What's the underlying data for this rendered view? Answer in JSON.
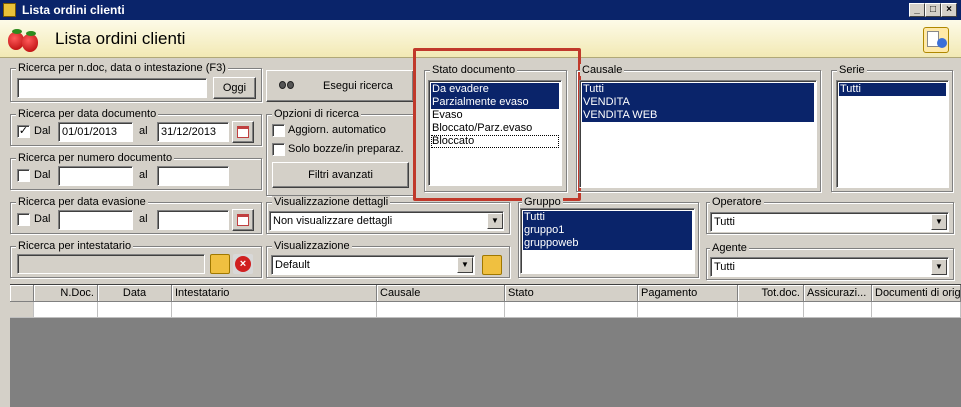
{
  "window": {
    "title": "Lista ordini clienti",
    "controls": [
      "_",
      "□",
      "×"
    ]
  },
  "header": {
    "title": "Lista ordini clienti"
  },
  "search_ndoc": {
    "legend": "Ricerca per n.doc, data o intestazione (F3)",
    "value": "",
    "button": "Oggi"
  },
  "esegui": {
    "label": "Esegui ricerca"
  },
  "data_doc": {
    "legend": "Ricerca per data documento",
    "checked": "✓",
    "dal_label": "Dal",
    "dal_value": "01/01/2013",
    "al_label": "al",
    "al_value": "31/12/2013"
  },
  "opzioni": {
    "legend": "Opzioni di ricerca",
    "option1": "Aggiorn. automatico",
    "option2": "Solo bozze/in preparaz.",
    "filtri_button": "Filtri avanzati"
  },
  "numero_doc": {
    "legend": "Ricerca per numero documento",
    "dal_label": "Dal",
    "al_label": "al"
  },
  "data_evasione": {
    "legend": "Ricerca per data evasione",
    "dal_label": "Dal",
    "al_label": "al"
  },
  "intestatario": {
    "legend": "Ricerca per intestatario"
  },
  "vis_dettagli": {
    "legend": "Visualizzazione dettagli",
    "selected": "Non visualizzare dettagli"
  },
  "visualizzazione": {
    "legend": "Visualizzazione",
    "selected": "Default"
  },
  "stato": {
    "legend": "Stato documento",
    "items": [
      "Da evadere",
      "Parzialmente evaso",
      "Evaso",
      "Bloccato/Parz.evaso",
      "Bloccato"
    ]
  },
  "causale": {
    "legend": "Causale",
    "items": [
      "Tutti",
      "VENDITA",
      "VENDITA WEB"
    ]
  },
  "serie": {
    "legend": "Serie",
    "items": [
      "Tutti"
    ]
  },
  "gruppo": {
    "legend": "Gruppo",
    "items": [
      "Tutti",
      "gruppo1",
      "gruppoweb"
    ]
  },
  "operatore": {
    "legend": "Operatore",
    "selected": "Tutti"
  },
  "agente": {
    "legend": "Agente",
    "selected": "Tutti"
  },
  "grid": {
    "columns": [
      "",
      "N.Doc.",
      "Data",
      "Intestatario",
      "Causale",
      "Stato",
      "Pagamento",
      "Tot.doc.",
      "Assicurazi...",
      "Documenti di orig"
    ]
  },
  "colors": {
    "selection": "#0a246a",
    "highlight_box": "#c0392b"
  }
}
